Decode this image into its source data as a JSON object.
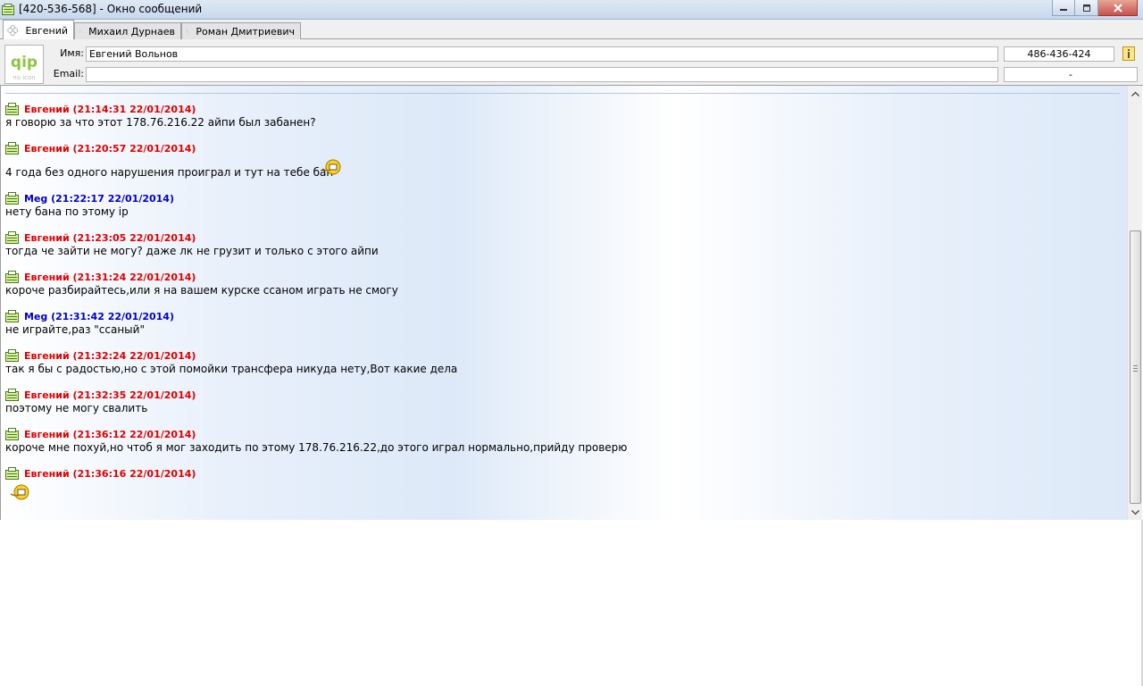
{
  "window": {
    "title": "[420-536-568] - Окно сообщений",
    "app_icon": "message-window-icon",
    "buttons": [
      "minimize-icon",
      "maximize-icon",
      "close-icon"
    ]
  },
  "tabs": [
    {
      "label": "Евгений",
      "active": true,
      "icon": "flower-status-icon"
    },
    {
      "label": "Михаил Дурнаев",
      "active": false,
      "icon": "flower-status-icon"
    },
    {
      "label": "Роман Дмитриевич",
      "active": false,
      "icon": "flower-status-icon"
    }
  ],
  "contact": {
    "logo": "qip-logo",
    "logo_text": "qip",
    "logo_sub": "no icon",
    "name_label": "Имя:",
    "name_value": "Евгений Вольнов",
    "email_label": "Email:",
    "email_value": "",
    "uin": "486-436-424",
    "extra": "-"
  },
  "messages": [
    {
      "author": "Евгений",
      "header": "Евгений (21:14:31 22/01/2014)",
      "color": "red",
      "text": "я говорю за что этот 178.76.216.22 айпи был забанен?"
    },
    {
      "author": "Евгений",
      "header": "Евгений (21:20:57 22/01/2014)",
      "color": "red",
      "text": "4 года без одного нарушения проиграл и тут на тебе бан",
      "smiley": true
    },
    {
      "author": "Meg",
      "header": "Meg (21:22:17 22/01/2014)",
      "color": "blue",
      "text": "нету бана по этому ip"
    },
    {
      "author": "Евгений",
      "header": "Евгений (21:23:05 22/01/2014)",
      "color": "red",
      "text": "тогда че зайти не могу? даже лк не грузит и только с этого айпи"
    },
    {
      "author": "Евгений",
      "header": "Евгений (21:31:24 22/01/2014)",
      "color": "red",
      "text": "короче разбирайтесь,или я на вашем курске ссаном играть не смогу"
    },
    {
      "author": "Meg",
      "header": "Meg (21:31:42 22/01/2014)",
      "color": "blue",
      "text": "не играйте,раз \"ссаный\""
    },
    {
      "author": "Евгений",
      "header": "Евгений (21:32:24 22/01/2014)",
      "color": "red",
      "text": "так я бы с радостью,но с этой помойки трансфера никуда нету,Вот какие дела"
    },
    {
      "author": "Евгений",
      "header": "Евгений (21:32:35 22/01/2014)",
      "color": "red",
      "text": "поэтому не могу свалить"
    },
    {
      "author": "Евгений",
      "header": "Евгений (21:36:12 22/01/2014)",
      "color": "red",
      "text": "короче мне похуй,но чтоб я мог заходить по этому 178.76.216.22,до этого играл нормально,прийду проверю"
    },
    {
      "author": "Евгений",
      "header": "Евгений (21:36:16 22/01/2014)",
      "color": "red",
      "text": "",
      "smiley_only": true
    }
  ],
  "colors": {
    "red": "#e00000",
    "blue": "#0000cc"
  }
}
